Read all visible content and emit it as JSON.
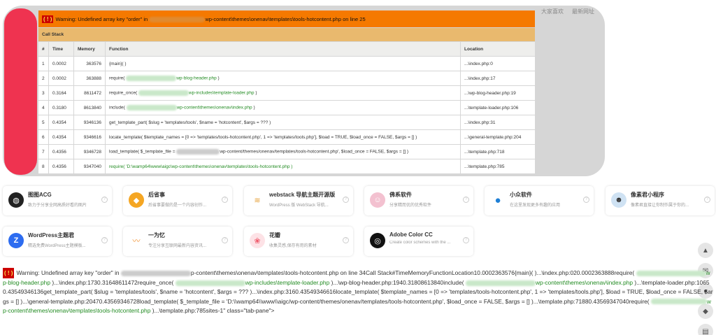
{
  "top_tabs": [
    "大家喜欢",
    "最新网址"
  ],
  "error": {
    "icon": "( ! )",
    "msg_pre": "Warning: Undefined array key \"order\" in",
    "msg_post": "wp-content\\themes\\onenav\\templates\\tools-hotcontent.php on line 25",
    "call_stack_label": "Call Stack",
    "columns": [
      "#",
      "Time",
      "Memory",
      "Function",
      "Location"
    ],
    "rows": [
      {
        "n": "1",
        "time": "0.0002",
        "mem": "363576",
        "fn": "{main}( )",
        "loc": "...\\index.php:0"
      },
      {
        "n": "2",
        "time": "0.0002",
        "mem": "363888",
        "fn_pre": "require(",
        "fn_green": "wp-blog-header.php",
        "fn_post": ")",
        "loc": "...\\index.php:17"
      },
      {
        "n": "3",
        "time": "0.3164",
        "mem": "8611472",
        "fn_pre": "require_once(",
        "fn_green": "wp-includes\\template-loader.php",
        "fn_post": ")",
        "loc": "...\\wp-blog-header.php:19"
      },
      {
        "n": "4",
        "time": "0.3180",
        "mem": "8613840",
        "fn_pre": "include(",
        "fn_green": "wp-content\\themes\\onenav\\index.php",
        "fn_post": ")",
        "loc": "...\\template-loader.php:106"
      },
      {
        "n": "5",
        "time": "0.4354",
        "mem": "9346136",
        "fn": "get_template_part( $slug = 'templates/tools', $name = 'hotcontent', $args = ??? )",
        "loc": "...\\index.php:31"
      },
      {
        "n": "6",
        "time": "0.4354",
        "mem": "9346616",
        "fn": "locate_template( $template_names = [0 => 'templates/tools-hotcontent.php', 1 => 'templates/tools.php'], $load = TRUE, $load_once = FALSE, $args = [] )",
        "loc": "...\\general-template.php:204"
      },
      {
        "n": "7",
        "time": "0.4356",
        "mem": "9346728",
        "fn_pre": "load_template( $_template_file =",
        "fn_post": "wp-content/themes/onenav/templates/tools-hotcontent.php', $load_once = FALSE, $args = [] )",
        "loc": "...\\template.php:718"
      },
      {
        "n": "8",
        "time": "0.4356",
        "mem": "9347040",
        "fn_green_only": "require( 'D:\\wamp64\\www\\aigc\\wp-content\\themes\\onenav\\templates\\tools-hotcontent.php )",
        "loc": "...\\template.php:785"
      }
    ]
  },
  "cards": [
    {
      "title": "图图ACG",
      "desc": "致力于分享全网高质好看的图片",
      "icon": "globe-icon",
      "color": "#222222"
    },
    {
      "title": "后省事",
      "desc": "后省事要做的是一个内容创作...",
      "icon": "fox-icon",
      "color": "#f5a623"
    },
    {
      "title": "webstack 导航主题开源版",
      "desc": "WordPress 版 WebStack 导航...",
      "icon": "stack-icon",
      "color": "#e6a23c"
    },
    {
      "title": "佛系软件",
      "desc": "分享精而优的优秀软件",
      "icon": "character-icon",
      "color": "#f3c1d0"
    },
    {
      "title": "小众软件",
      "desc": "在这里发现更多有趣的应用",
      "icon": "drop-icon",
      "color": "#1e7fd6"
    },
    {
      "title": "像素君小程序",
      "desc": "像素君直接让你制作属于你的...",
      "icon": "avatar-icon",
      "color": "#cfe2f3"
    },
    {
      "title": "WordPress主题君",
      "desc": "精选免费WordPress主题模板...",
      "icon": "z-logo-icon",
      "color": "#2d6cf0"
    },
    {
      "title": "一为忆",
      "desc": "专注分享互联网最新内容资讯...",
      "icon": "wave-icon",
      "color": "#f08a24"
    },
    {
      "title": "花瓣",
      "desc": "收集灵感,保存有用的素材",
      "icon": "petal-icon",
      "color": "#ef5a6b"
    },
    {
      "title": "Adobe Color CC",
      "desc": "Create color schemes with the ...",
      "icon": "adobe-color-icon",
      "color": "#111111"
    }
  ],
  "right_buttons": [
    "arrow-up-icon",
    "wechat-icon",
    "comment-icon",
    "tag-icon",
    "calendar-icon"
  ],
  "bottom": {
    "p1": "Warning: Undefined array key \"order\" in",
    "p2": "p-content\\themes\\onenav\\templates\\tools-hotcontent.php on line 34Call Stack#TimeMemoryFunctionLocation10.0002363576{main}( )...\\index.php:020.0002363888require(",
    "p3": "wp-blog-header.php",
    "p4": ")...\\index.php:1730.31648611472require_once(",
    "p5": "wp-includes\\template-loader.php",
    "p6": ")...\\wp-blog-header.php:1940.31808613840include(",
    "p7": "wp-content\\themes\\onenav\\index.php",
    "p8": ")...\\template-loader.php:10650.43549346136get_template_part( $slug = 'templates/tools', $name = 'hotcontent', $args = ??? )...\\index.php:3160.43549346616locate_template( $template_names = [0 => 'templates/tools-hotcontent.php', 1 => 'templates/tools.php'], $load = TRUE, $load_once = FALSE, $args = [] )...\\general-template.php:20470.43569346728load_template( $_template_file = 'D:\\\\wamp64\\\\www\\\\aigc/wp-content/themes/onenav/templates/tools-hotcontent.php', $load_once = FALSE, $args = [] )...\\template.php:71880.43569347040require(",
    "p9": "wp-content\\themes\\onenav\\templates\\tools-hotcontent.php",
    "p10": ")...\\template.php:785sites-1\" class=\"tab-pane\">"
  }
}
